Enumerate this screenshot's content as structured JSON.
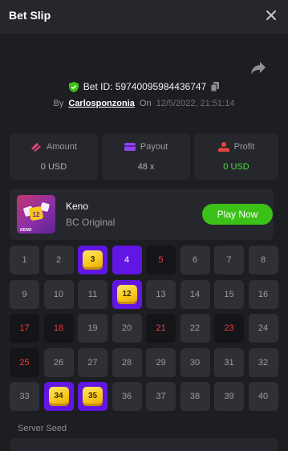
{
  "header": {
    "title": "Bet Slip"
  },
  "bet": {
    "id_label": "Bet ID: 59740095984436747",
    "by_label": "By",
    "user": "Carlosponzonia",
    "on_label": "On",
    "date": "12/5/2022, 21:51:14"
  },
  "stats": {
    "amount": {
      "label": "Amount",
      "value": "0 USD"
    },
    "payout": {
      "label": "Payout",
      "value": "48 x"
    },
    "profit": {
      "label": "Profit",
      "value": "0 USD"
    }
  },
  "game": {
    "name": "Keno",
    "subtitle": "BC Original",
    "play_label": "Play Now",
    "thumb_tile": "12",
    "thumb_caption": "KENO"
  },
  "grid": {
    "cells": [
      {
        "n": "1",
        "state": "normal"
      },
      {
        "n": "2",
        "state": "normal"
      },
      {
        "n": "3",
        "state": "hit"
      },
      {
        "n": "4",
        "state": "pick"
      },
      {
        "n": "5",
        "state": "drawn"
      },
      {
        "n": "6",
        "state": "normal"
      },
      {
        "n": "7",
        "state": "normal"
      },
      {
        "n": "8",
        "state": "normal"
      },
      {
        "n": "9",
        "state": "normal"
      },
      {
        "n": "10",
        "state": "normal"
      },
      {
        "n": "11",
        "state": "normal"
      },
      {
        "n": "12",
        "state": "hit"
      },
      {
        "n": "13",
        "state": "normal"
      },
      {
        "n": "14",
        "state": "normal"
      },
      {
        "n": "15",
        "state": "normal"
      },
      {
        "n": "16",
        "state": "normal"
      },
      {
        "n": "17",
        "state": "drawn"
      },
      {
        "n": "18",
        "state": "drawn"
      },
      {
        "n": "19",
        "state": "normal"
      },
      {
        "n": "20",
        "state": "normal"
      },
      {
        "n": "21",
        "state": "drawn"
      },
      {
        "n": "22",
        "state": "normal"
      },
      {
        "n": "23",
        "state": "drawn"
      },
      {
        "n": "24",
        "state": "normal"
      },
      {
        "n": "25",
        "state": "drawn"
      },
      {
        "n": "26",
        "state": "normal"
      },
      {
        "n": "27",
        "state": "normal"
      },
      {
        "n": "28",
        "state": "normal"
      },
      {
        "n": "29",
        "state": "normal"
      },
      {
        "n": "30",
        "state": "normal"
      },
      {
        "n": "31",
        "state": "normal"
      },
      {
        "n": "32",
        "state": "normal"
      },
      {
        "n": "33",
        "state": "normal"
      },
      {
        "n": "34",
        "state": "hit"
      },
      {
        "n": "35",
        "state": "hit"
      },
      {
        "n": "36",
        "state": "normal"
      },
      {
        "n": "37",
        "state": "normal"
      },
      {
        "n": "38",
        "state": "normal"
      },
      {
        "n": "39",
        "state": "normal"
      },
      {
        "n": "40",
        "state": "normal"
      }
    ]
  },
  "seed": {
    "label": "Server Seed"
  },
  "colors": {
    "accent_purple": "#6116e3",
    "win_green": "#3bc117",
    "profit_green": "#4ade3a",
    "drawn_red": "#f03a3a",
    "gem_yellow": "#f8c91c"
  }
}
